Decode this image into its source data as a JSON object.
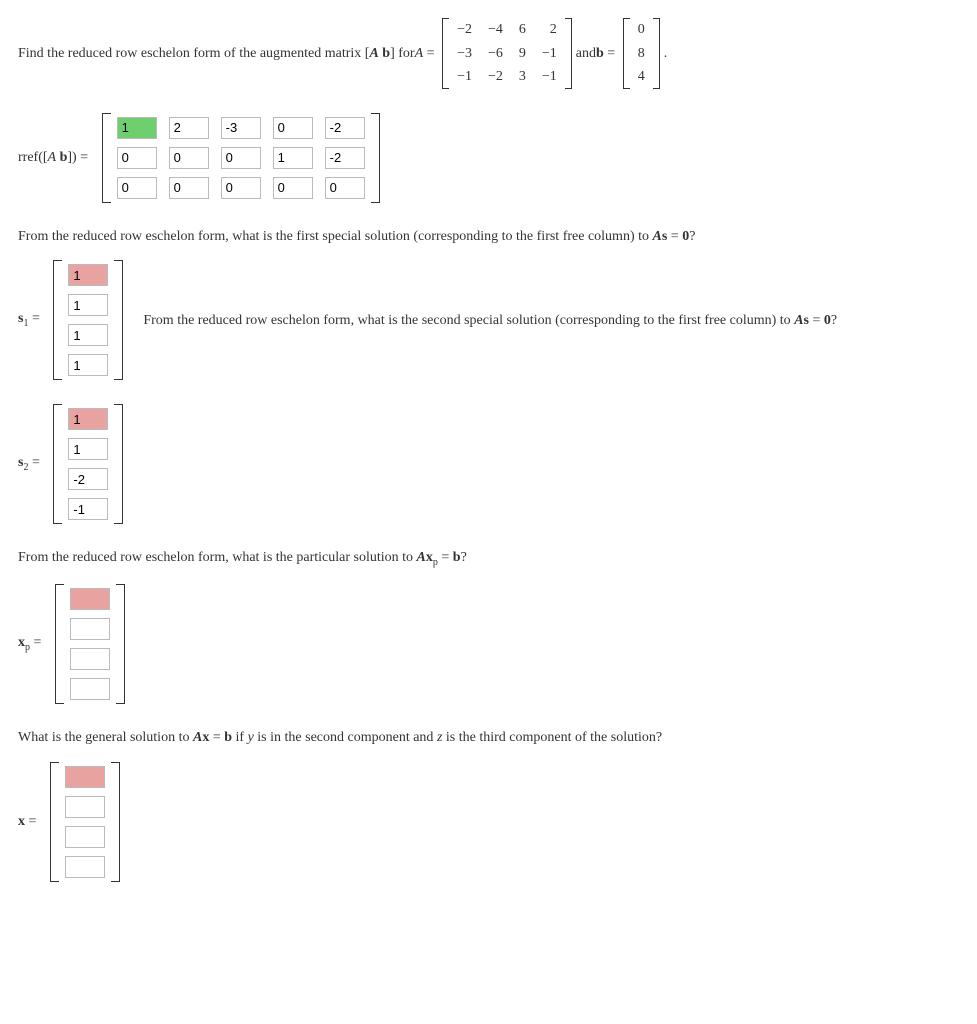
{
  "q_top_pre": "Find the reduced row eschelon form of the augmented matrix [",
  "q_top_Ab": "A b",
  "q_top_mid": "] for ",
  "q_top_Aeq": "A = ",
  "q_top_and": " and ",
  "q_top_beq": "b = ",
  "q_top_period": " .",
  "A_matrix": [
    [
      "−2",
      "−4",
      "6",
      "2"
    ],
    [
      "−3",
      "−6",
      "9",
      "−1"
    ],
    [
      "−1",
      "−2",
      "3",
      "−1"
    ]
  ],
  "b_vector": [
    [
      "0"
    ],
    [
      "8"
    ],
    [
      "4"
    ]
  ],
  "rref_label": "rref([A b]) = ",
  "rref": [
    [
      {
        "v": "1",
        "c": "green"
      },
      {
        "v": "2",
        "c": ""
      },
      {
        "v": "-3",
        "c": ""
      },
      {
        "v": "0",
        "c": ""
      },
      {
        "v": "-2",
        "c": ""
      }
    ],
    [
      {
        "v": "0",
        "c": ""
      },
      {
        "v": "0",
        "c": ""
      },
      {
        "v": "0",
        "c": ""
      },
      {
        "v": "1",
        "c": ""
      },
      {
        "v": "-2",
        "c": ""
      }
    ],
    [
      {
        "v": "0",
        "c": ""
      },
      {
        "v": "0",
        "c": ""
      },
      {
        "v": "0",
        "c": ""
      },
      {
        "v": "0",
        "c": ""
      },
      {
        "v": "0",
        "c": ""
      }
    ]
  ],
  "q_s1_pre": "From the reduced row eschelon form, what is the first special solution (corresponding to the first free column) to ",
  "q_As0": "As = 0",
  "qmark": "?",
  "s1_label": "s₁ = ",
  "s1": [
    {
      "v": "1",
      "c": "pink"
    },
    {
      "v": "1",
      "c": ""
    },
    {
      "v": "1",
      "c": ""
    },
    {
      "v": "1",
      "c": ""
    }
  ],
  "q_s2_beside": "From the reduced row eschelon form, what is the second special solution (corresponding to the first free column) to ",
  "s2_label": "s₂ = ",
  "s2": [
    {
      "v": "1",
      "c": "pink"
    },
    {
      "v": "1",
      "c": ""
    },
    {
      "v": "-2",
      "c": ""
    },
    {
      "v": "-1",
      "c": ""
    }
  ],
  "q_xp_pre": "From the reduced row eschelon form, what is the particular solution to ",
  "q_xp_eq": "Axₚ = b",
  "xp_label": "xₚ = ",
  "xp": [
    {
      "v": "",
      "c": "pink"
    },
    {
      "v": "",
      "c": ""
    },
    {
      "v": "",
      "c": ""
    },
    {
      "v": "",
      "c": ""
    }
  ],
  "q_x_pre": "What is the general solution to ",
  "q_x_eq": "Ax = b",
  "q_x_mid": " if ",
  "q_x_y": "y",
  "q_x_mid2": " is in the second component and ",
  "q_x_z": "z",
  "q_x_end": " is the third component of the solution?",
  "x_label": "x = ",
  "x": [
    {
      "v": "",
      "c": "pink"
    },
    {
      "v": "",
      "c": ""
    },
    {
      "v": "",
      "c": ""
    },
    {
      "v": "",
      "c": ""
    }
  ]
}
